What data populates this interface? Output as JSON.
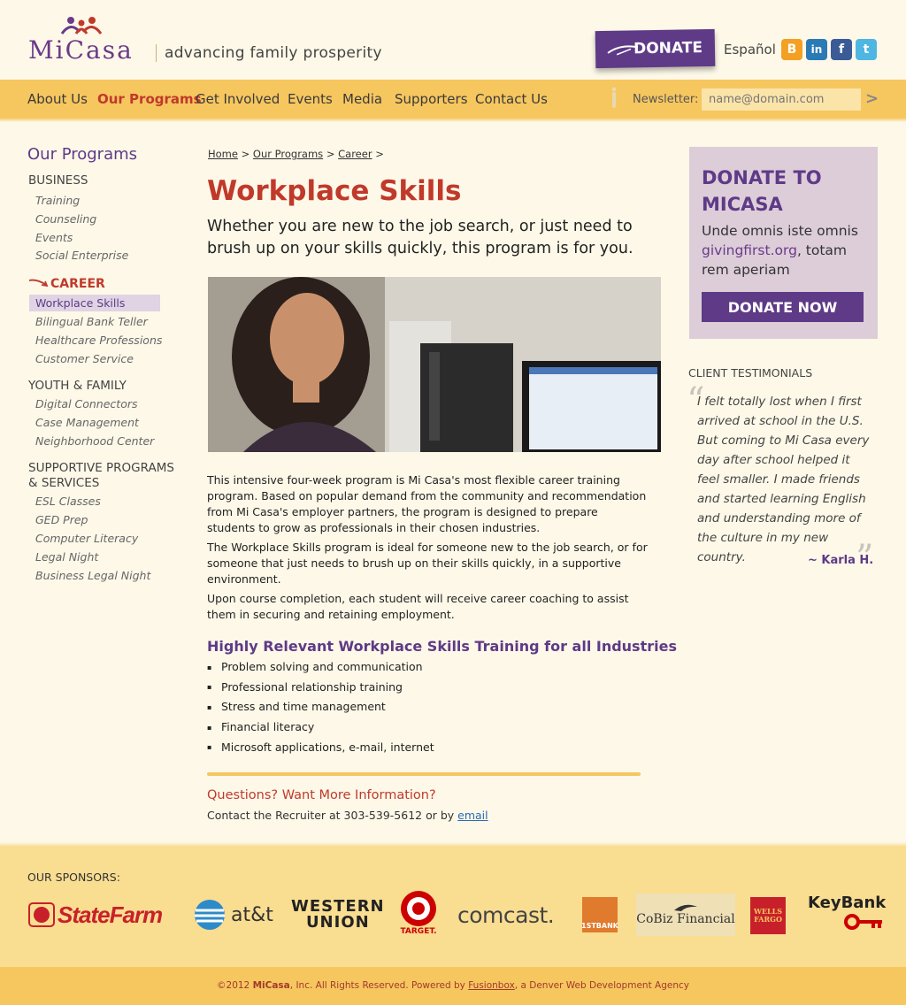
{
  "header": {
    "logo_text": "MiCasa",
    "tagline": "advancing family prosperity",
    "donate_label": "DONATE",
    "language_link": "Español",
    "social": [
      "blogger-icon",
      "linkedin-icon",
      "facebook-icon",
      "twitter-icon"
    ]
  },
  "nav": {
    "items": [
      "About Us",
      "Our Programs",
      "Get Involved",
      "Events",
      "Media",
      "Supporters",
      "Contact Us"
    ],
    "active": "Our Programs",
    "newsletter_label": "Newsletter:",
    "newsletter_placeholder": "name@domain.com",
    "newsletter_submit": ">"
  },
  "sidebar": {
    "title": "Our Programs",
    "business": {
      "label": "BUSINESS",
      "items": [
        "Training",
        "Counseling",
        "Events",
        "Social Enterprise"
      ]
    },
    "career": {
      "label": "CAREER",
      "items": [
        "Workplace Skills",
        "Bilingual Bank Teller",
        "Healthcare Professions",
        "Customer Service"
      ],
      "active": "Workplace Skills"
    },
    "youth": {
      "label": "YOUTH & FAMILY",
      "items": [
        "Digital Connectors",
        "Case Management",
        "Neighborhood Center"
      ]
    },
    "supportive": {
      "label_line1": "SUPPORTIVE PROGRAMS",
      "label_line2": "& SERVICES",
      "items": [
        "ESL Classes",
        "GED Prep",
        "Computer Literacy",
        "Legal Night",
        "Business Legal Night"
      ]
    }
  },
  "main": {
    "breadcrumb": [
      "Home",
      "Our Programs",
      "Career"
    ],
    "breadcrumb_sep": ">",
    "title": "Workplace Skills",
    "intro": "Whether you are new to the job search, or just need to brush up on your skills quickly, this program is for you.",
    "para1": "This intensive four-week program is Mi Casa's most flexible career training program. Based on popular demand from the community and recommendation from Mi Casa's employer partners, the program is designed to prepare students to grow as professionals in their chosen industries.",
    "para2": "The Workplace Skills program is ideal for someone new to the job search, or for someone that just needs to brush up on their skills quickly, in a supportive environment.",
    "para3": "Upon course completion, each student will receive career coaching to assist them in securing and retaining employment.",
    "subhead": "Highly Relevant Workplace Skills Training for all Industries",
    "bullets": [
      "Problem solving and communication",
      "Professional relationship training",
      "Stress and time management",
      "Financial literacy",
      "Microsoft applications, e-mail, internet"
    ],
    "questions": "Questions? Want More Information?",
    "contact_prefix": "Contact the Recruiter at 303-539-5612 or by",
    "contact_link": "email"
  },
  "donate_box": {
    "title": "DONATE TO MICASA",
    "text_before": "Unde omnis iste omnis",
    "link": "givingfirst.org",
    "text_after": ", totam rem aperiam",
    "button": "DONATE NOW"
  },
  "testimonial": {
    "heading": "CLIENT TESTIMONIALS",
    "quote": "I felt totally lost when I first arrived at school in the U.S. But coming to Mi Casa every day after school helped it feel smaller. I made friends and started learning English and understanding more of the culture in my new country.",
    "author": "~ Karla H."
  },
  "sponsors": {
    "heading": "OUR SPONSORS:",
    "logos": [
      "StateFarm",
      "at&t",
      "WESTERN",
      "UNION",
      "TARGET.",
      "comcast.",
      "1STBANK",
      "CoBiz Financial",
      "WELLS",
      "FARGO",
      "KeyBank"
    ]
  },
  "footer": {
    "prefix": "©2012",
    "brand": "MiCasa",
    "middle": ", Inc. All Rights Reserved.  Powered by",
    "link": "Fusionbox",
    "suffix": ", a Denver Web Development Agency"
  },
  "colors": {
    "purple": "#5e3a87",
    "red": "#c0392b",
    "gold": "#f6c65f",
    "cream": "#fdf8e8"
  }
}
